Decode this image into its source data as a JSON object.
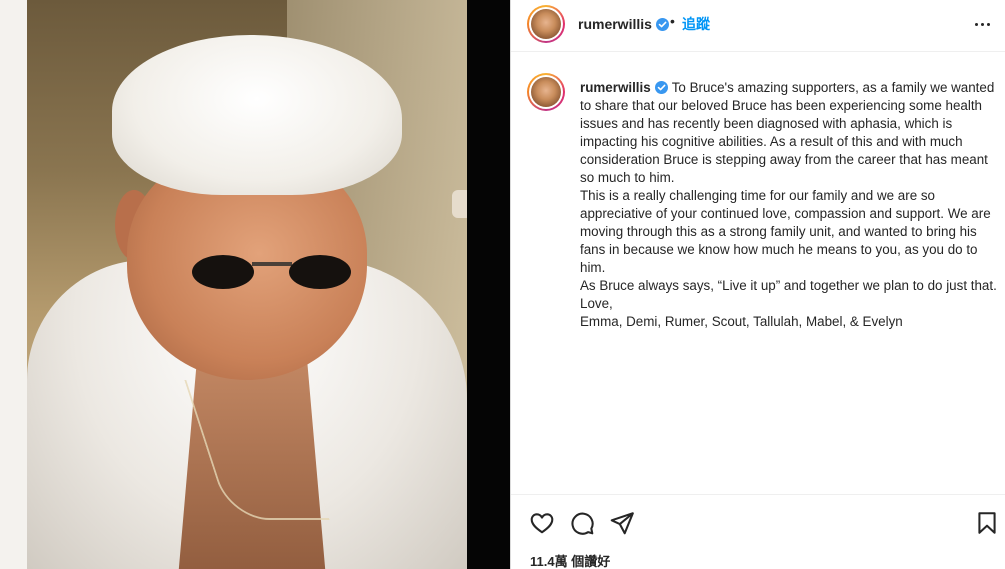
{
  "post": {
    "username": "rumerwillis",
    "dot": "•",
    "follow_label": "追蹤",
    "verified": true
  },
  "caption": {
    "username": "rumerwillis",
    "paragraphs": [
      "To Bruce's amazing supporters, as a family we wanted to share that our beloved Bruce has been experiencing some health issues and has recently been diagnosed with aphasia, which is impacting his cognitive abilities. As a result of this and with much consideration Bruce is stepping away from the career that has meant so much to him.",
      "This is a really challenging time for our family and we are so appreciative of your continued love, compassion and support. We are moving through this as a strong family unit, and wanted to bring his fans in because we know how much he means to you, as you do to him.",
      "As Bruce always says, “Live it up” and together we plan to do just that.",
      "Love,",
      "Emma, Demi, Rumer, Scout, Tallulah, Mabel, & Evelyn"
    ]
  },
  "actions": {
    "icons": [
      "heart-icon",
      "comment-icon",
      "share-icon",
      "bookmark-icon"
    ],
    "likes_text": "11.4萬 個讚好"
  },
  "colors": {
    "link_blue": "#0095f6",
    "verified_blue": "#3897f0",
    "text": "#262626"
  }
}
